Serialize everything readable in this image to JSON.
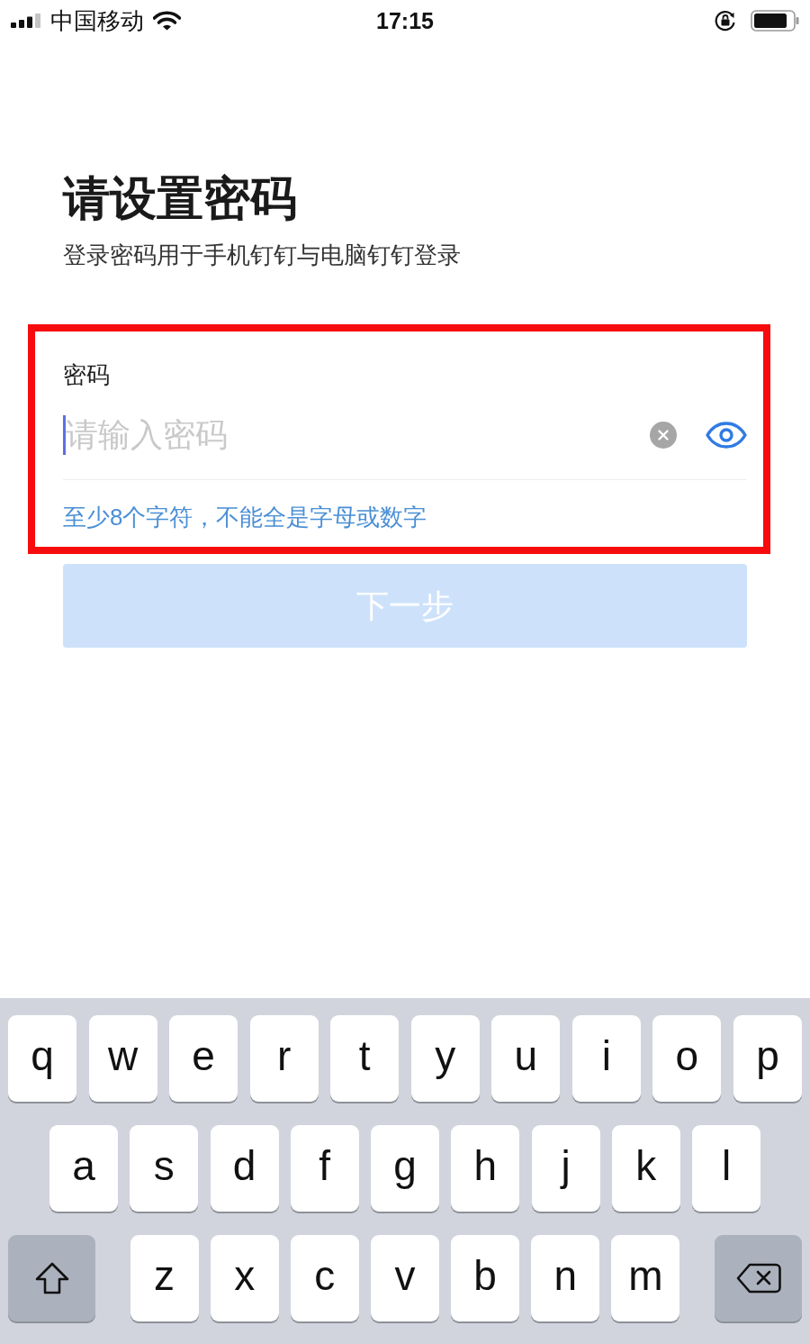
{
  "status_bar": {
    "carrier": "中国移动",
    "time": "17:15"
  },
  "title": "请设置密码",
  "subtitle": "登录密码用于手机钉钉与电脑钉钉登录",
  "password_field": {
    "label": "密码",
    "placeholder": "请输入密码",
    "focused": true,
    "highlighted": true,
    "hint": "至少8个字符，不能全是字母或数字"
  },
  "next_button": {
    "label": "下一步",
    "disabled": true
  },
  "keyboard": {
    "rows": [
      [
        {
          "kind": "letter",
          "label": "q"
        },
        {
          "kind": "letter",
          "label": "w"
        },
        {
          "kind": "letter",
          "label": "e"
        },
        {
          "kind": "letter",
          "label": "r"
        },
        {
          "kind": "letter",
          "label": "t"
        },
        {
          "kind": "letter",
          "label": "y"
        },
        {
          "kind": "letter",
          "label": "u"
        },
        {
          "kind": "letter",
          "label": "i"
        },
        {
          "kind": "letter",
          "label": "o"
        },
        {
          "kind": "letter",
          "label": "p"
        }
      ],
      [
        {
          "kind": "letter",
          "label": "a"
        },
        {
          "kind": "letter",
          "label": "s"
        },
        {
          "kind": "letter",
          "label": "d"
        },
        {
          "kind": "letter",
          "label": "f"
        },
        {
          "kind": "letter",
          "label": "g"
        },
        {
          "kind": "letter",
          "label": "h"
        },
        {
          "kind": "letter",
          "label": "j"
        },
        {
          "kind": "letter",
          "label": "k"
        },
        {
          "kind": "letter",
          "label": "l"
        }
      ],
      [
        {
          "kind": "shift"
        },
        {
          "kind": "letter",
          "label": "z"
        },
        {
          "kind": "letter",
          "label": "x"
        },
        {
          "kind": "letter",
          "label": "c"
        },
        {
          "kind": "letter",
          "label": "v"
        },
        {
          "kind": "letter",
          "label": "b"
        },
        {
          "kind": "letter",
          "label": "n"
        },
        {
          "kind": "letter",
          "label": "m"
        },
        {
          "kind": "delete"
        }
      ]
    ]
  }
}
